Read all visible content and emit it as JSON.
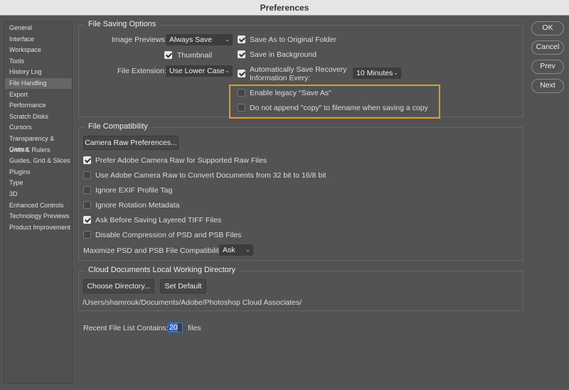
{
  "window": {
    "title": "Preferences"
  },
  "sidebar": {
    "items": [
      "General",
      "Interface",
      "Workspace",
      "Tools",
      "History Log",
      "File Handling",
      "Export",
      "Performance",
      "Scratch Disks",
      "Cursors",
      "Transparency & Gamut",
      "Units & Rulers",
      "Guides, Grid & Slices",
      "Plugins",
      "Type",
      "3D",
      "Enhanced Controls",
      "Technology Previews",
      "Product Improvement"
    ],
    "selected": "File Handling"
  },
  "buttons": {
    "ok": "OK",
    "cancel": "Cancel",
    "prev": "Prev",
    "next": "Next"
  },
  "file_saving": {
    "title": "File Saving Options",
    "image_previews_label": "Image Previews:",
    "image_previews_value": "Always Save",
    "thumbnail": {
      "label": "Thumbnail",
      "checked": true
    },
    "file_extension_label": "File Extension:",
    "file_extension_value": "Use Lower Case",
    "save_as_original": {
      "label": "Save As to Original Folder",
      "checked": true
    },
    "save_background": {
      "label": "Save in Background",
      "checked": true
    },
    "auto_save": {
      "label1": "Automatically Save Recovery",
      "label2": "Information Every:",
      "checked": true,
      "value": "10 Minutes"
    },
    "legacy_save_as": {
      "label": "Enable legacy \"Save As\"",
      "checked": false
    },
    "no_copy": {
      "label": "Do not append \"copy\" to filename when saving a copy",
      "checked": false
    },
    "highlight_color": "#e59a1f"
  },
  "compat": {
    "title": "File Compatibility",
    "camera_raw_button": "Camera Raw Preferences...",
    "options": [
      {
        "label": "Prefer Adobe Camera Raw for Supported Raw Files",
        "checked": true
      },
      {
        "label": "Use Adobe Camera Raw to Convert Documents from 32 bit to 16/8 bit",
        "checked": false
      },
      {
        "label": "Ignore EXIF Profile Tag",
        "checked": false
      },
      {
        "label": "Ignore Rotation Metadata",
        "checked": false
      },
      {
        "label": "Ask Before Saving Layered TIFF Files",
        "checked": true
      },
      {
        "label": "Disable Compression of PSD and PSB Files",
        "checked": false
      }
    ],
    "maximize_label": "Maximize PSD and PSB File Compatibility:",
    "maximize_value": "Ask"
  },
  "cloud": {
    "title": "Cloud Documents Local Working Directory",
    "choose_button": "Choose Directory...",
    "default_button": "Set Default",
    "path": "/Users/shamrouk/Documents/Adobe/Photoshop Cloud Associates/"
  },
  "recent": {
    "label": "Recent File List Contains:",
    "value": "20",
    "suffix": "files"
  }
}
